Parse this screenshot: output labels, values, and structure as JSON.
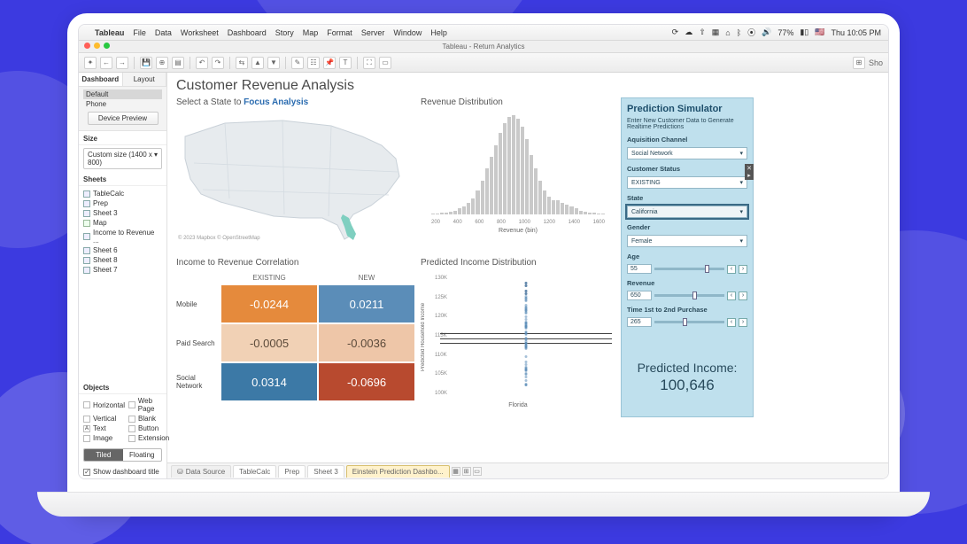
{
  "mac_menu": {
    "app": "Tableau",
    "items": [
      "File",
      "Data",
      "Worksheet",
      "Dashboard",
      "Story",
      "Map",
      "Format",
      "Server",
      "Window",
      "Help"
    ],
    "battery": "77%",
    "clock": "Thu 10:05 PM"
  },
  "window_title": "Tableau - Return Analytics",
  "toolbar_right": "Sho",
  "left": {
    "tabs": {
      "dashboard": "Dashboard",
      "layout": "Layout"
    },
    "device_header": {
      "default": "Default",
      "phone": "Phone",
      "preview": "Device Preview"
    },
    "size_header": "Size",
    "size_value": "Custom size (1400 x 800)",
    "sheets_header": "Sheets",
    "sheets": [
      "TableCalc",
      "Prep",
      "Sheet 3",
      "Map",
      "Income to Revenue ...",
      "Sheet 6",
      "Sheet 8",
      "Sheet 7"
    ],
    "objects_header": "Objects",
    "objects": [
      "Horizontal",
      "Web Page",
      "Vertical",
      "Blank",
      "Text",
      "Button",
      "Image",
      "Extension"
    ],
    "tiled": "Tiled",
    "floating": "Floating",
    "show_title": "Show dashboard title"
  },
  "dash": {
    "title": "Customer Revenue Analysis",
    "map_title_a": "Select a State to ",
    "map_title_b": "Focus Analysis",
    "map_credit": "© 2023 Mapbox © OpenStreetMap",
    "hist_title": "Revenue Distribution",
    "hist_xlabel": "Revenue (bin)",
    "heat_title": "Income to Revenue Correlation",
    "heat_cols": [
      "EXISTING",
      "NEW"
    ],
    "heat_rows": [
      "Mobile",
      "Paid Search",
      "Social Network"
    ],
    "dot_title": "Predicted Income Distribution",
    "dot_ylabel": "Predicted Household Income",
    "dot_xlabel": "Florida"
  },
  "chart_data": {
    "histogram": {
      "type": "bar",
      "xlabel": "Revenue (bin)",
      "x_ticks": [
        200,
        400,
        600,
        800,
        1000,
        1200,
        1400,
        1600
      ],
      "values": [
        1,
        1,
        2,
        2,
        3,
        4,
        6,
        8,
        12,
        16,
        24,
        34,
        46,
        58,
        70,
        82,
        92,
        98,
        100,
        96,
        88,
        76,
        60,
        46,
        34,
        24,
        18,
        14,
        14,
        12,
        10,
        8,
        6,
        4,
        3,
        2,
        2,
        1,
        1
      ]
    },
    "heatmap": {
      "type": "heatmap",
      "rows": [
        "Mobile",
        "Paid Search",
        "Social Network"
      ],
      "cols": [
        "EXISTING",
        "NEW"
      ],
      "values": [
        [
          -0.0244,
          0.0211
        ],
        [
          -0.0005,
          -0.0036
        ],
        [
          0.0314,
          -0.0696
        ]
      ],
      "colors": [
        [
          "#e58a3c",
          "#5b8db8"
        ],
        [
          "#f1d1b5",
          "#eec6a8"
        ],
        [
          "#3c79a6",
          "#b84a2f"
        ]
      ]
    },
    "dotplot": {
      "type": "scatter",
      "ylabel": "Predicted Household Income",
      "y_ticks": [
        "130K",
        "125K",
        "120K",
        "115K",
        "110K",
        "105K",
        "100K"
      ],
      "category": "Florida",
      "ref_lines": [
        0.48,
        0.52,
        0.56
      ]
    }
  },
  "sim": {
    "title": "Prediction Simulator",
    "desc": "Enter New Customer Data to Generate Realtime Predictions",
    "fields": {
      "aq_label": "Aquisition Channel",
      "aq_value": "Social Network",
      "cs_label": "Customer Status",
      "cs_value": "EXISTING",
      "st_label": "State",
      "st_value": "California",
      "g_label": "Gender",
      "g_value": "Female",
      "age_label": "Age",
      "age_value": "55",
      "rev_label": "Revenue",
      "rev_value": "650",
      "t_label": "Time 1st to 2nd Purchase",
      "t_value": "265"
    },
    "result_label": "Predicted Income:",
    "result_value": "100,646"
  },
  "sheet_tabs": {
    "ds": "Data Source",
    "items": [
      "TableCalc",
      "Prep",
      "Sheet 3"
    ],
    "active": "Einstein Prediction Dashbo..."
  }
}
